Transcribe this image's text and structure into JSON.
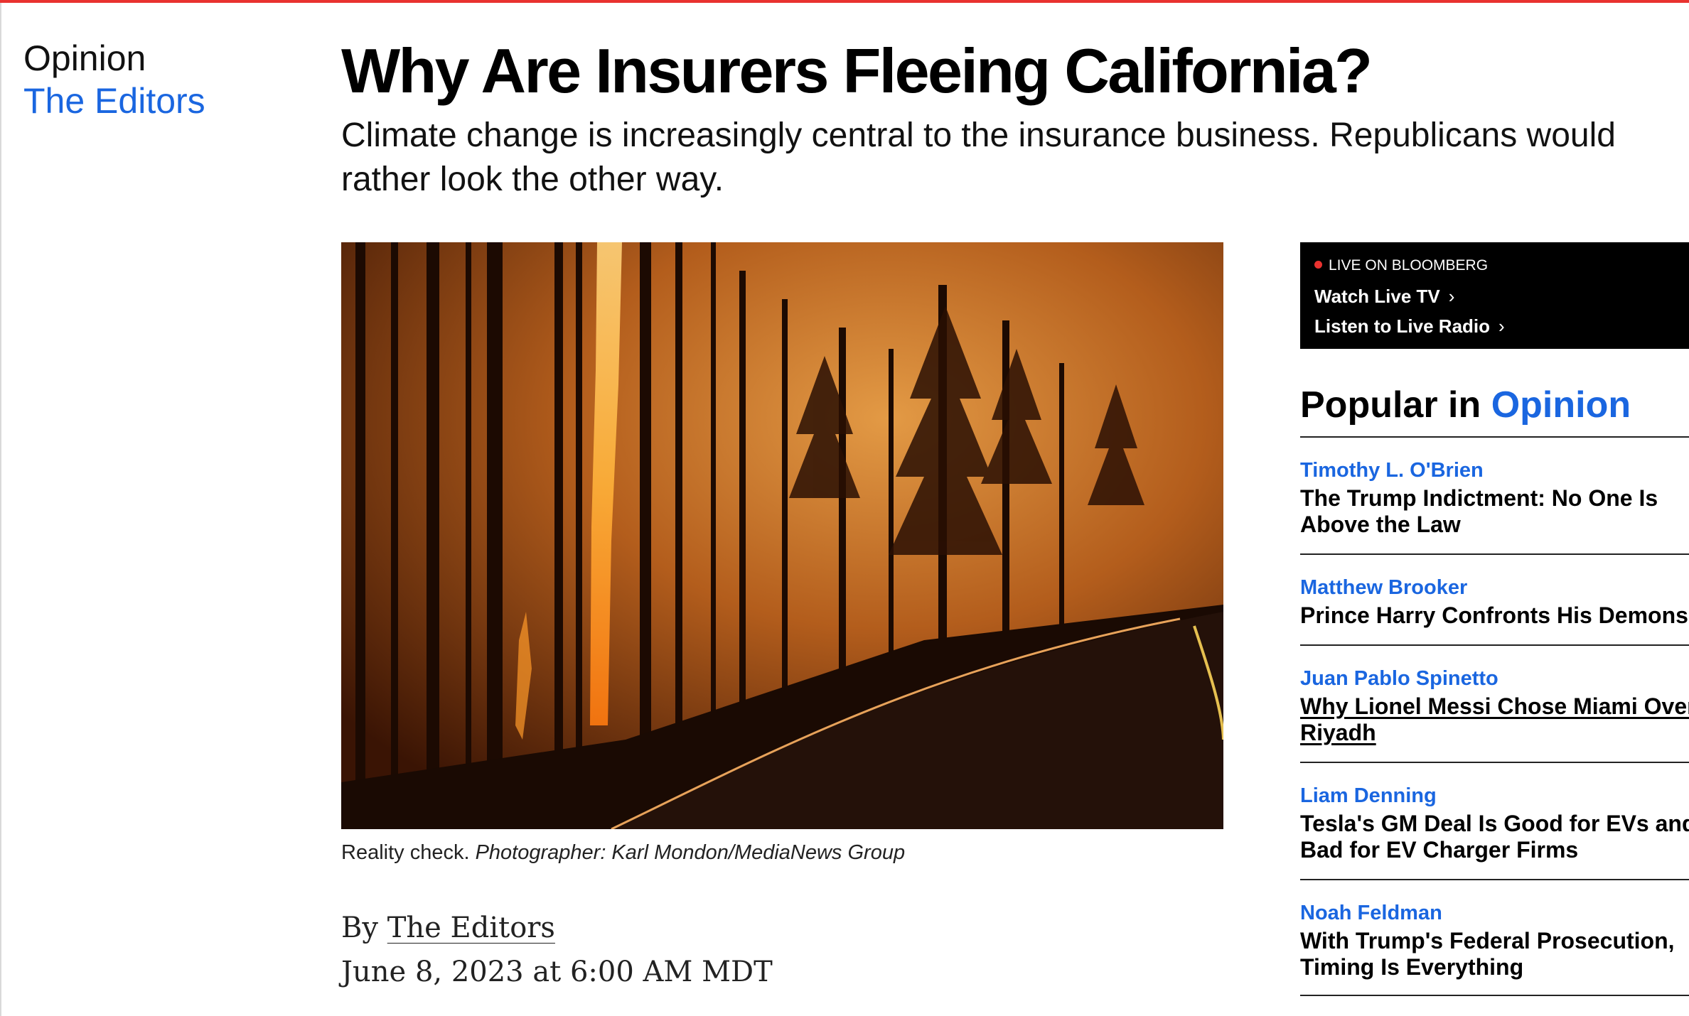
{
  "kicker": {
    "section": "Opinion",
    "author": "The Editors"
  },
  "article": {
    "headline": "Why Are Insurers Fleeing California?",
    "dek": "Climate change is increasingly central to the insurance business. Republicans would rather look the other way.",
    "caption": "Reality check.",
    "photo_credit": "Photographer: Karl Mondon/MediaNews Group",
    "byline_prefix": "By",
    "byline_name": "The Editors",
    "date": "June 8, 2023 at 6:00 AM MDT"
  },
  "live": {
    "badge": "LIVE ON BLOOMBERG",
    "watch": "Watch Live TV",
    "listen": "Listen to Live Radio"
  },
  "popular": {
    "title_prefix": "Popular in",
    "title_accent": "Opinion",
    "items": [
      {
        "author": "Timothy L. O'Brien",
        "title": "The Trump Indictment: No One Is Above the Law"
      },
      {
        "author": "Matthew Brooker",
        "title": "Prince Harry Confronts His Demons"
      },
      {
        "author": "Juan Pablo Spinetto",
        "title": "Why Lionel Messi Chose Miami Over Riyadh"
      },
      {
        "author": "Liam Denning",
        "title": "Tesla's GM Deal Is Good for EVs and Bad for EV Charger Firms"
      },
      {
        "author": "Noah Feldman",
        "title": "With Trump's Federal Prosecution, Timing Is Everything"
      }
    ]
  },
  "colors": {
    "accent_blue": "#1a66e0",
    "live_red": "#e9322f"
  },
  "icons": {
    "live_chevron": "chevron-right-icon",
    "live_dot": "live-dot-icon"
  }
}
